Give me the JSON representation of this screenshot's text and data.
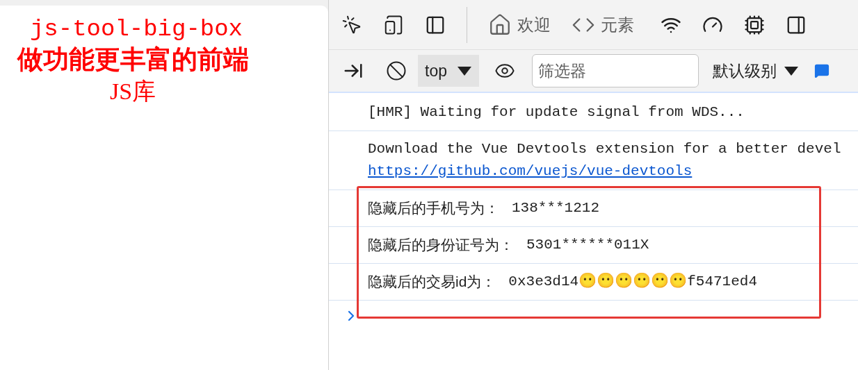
{
  "page": {
    "title": "js-tool-big-box",
    "subtitle": "做功能更丰富的前端",
    "library": "JS库"
  },
  "devtools": {
    "tabs": [
      {
        "label": "欢迎",
        "kind": "home",
        "selected": false
      },
      {
        "label": "元素",
        "kind": "code",
        "selected": false
      }
    ],
    "context": "top",
    "filter": {
      "placeholder": "筛选器"
    },
    "levels": "默认级别"
  },
  "console": {
    "messages": [
      {
        "kind": "text",
        "text": "[HMR] Waiting for update signal from WDS...",
        "annotated": false
      },
      {
        "kind": "link",
        "text": "Download the Vue Devtools extension for a better devel",
        "link": "https://github.com/vuejs/vue-devtools",
        "annotated": false
      },
      {
        "kind": "log",
        "label": "隐藏后的手机号为：",
        "value": "138***1212",
        "annotated": true
      },
      {
        "kind": "log",
        "label": "隐藏后的身份证号为：",
        "value": "5301******011X",
        "annotated": true
      },
      {
        "kind": "log",
        "label": "隐藏后的交易id为：",
        "value": "0x3e3d14😶😶😶😶😶😶f5471ed4",
        "annotated": true
      }
    ]
  }
}
